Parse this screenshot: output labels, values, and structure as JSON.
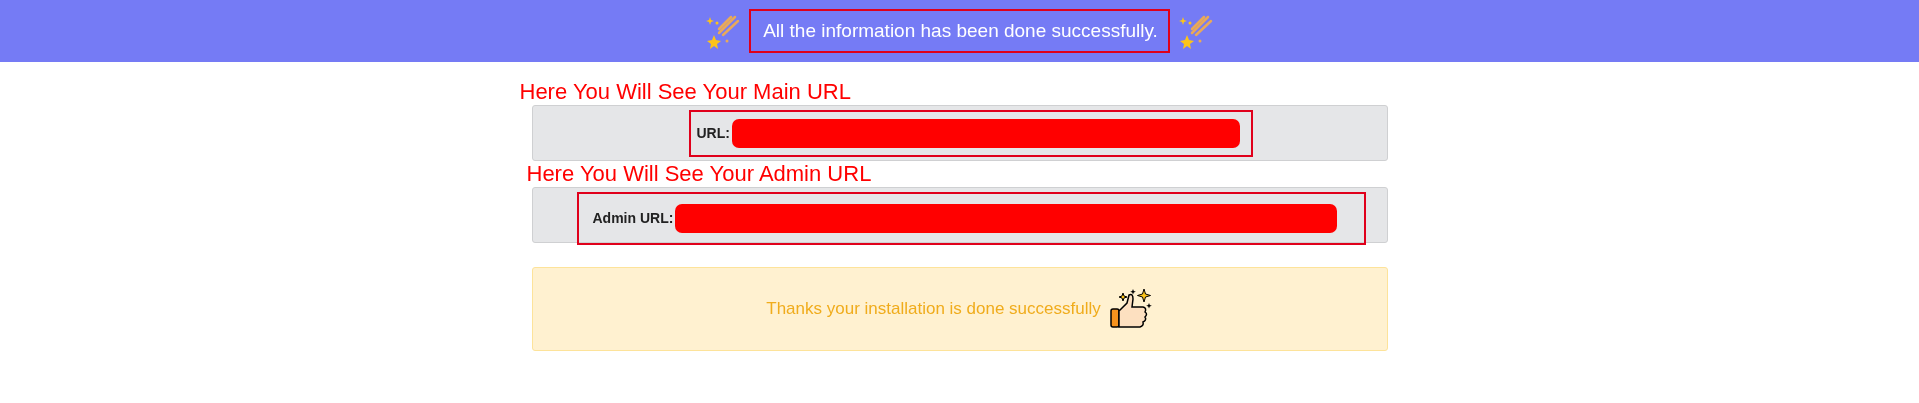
{
  "banner": {
    "message": "All the information has been done successfully."
  },
  "url_sections": [
    {
      "annotation": "Here You Will See Your Main URL",
      "label": "URL:",
      "kind": "main"
    },
    {
      "annotation": "Here You Will See Your Admin URL",
      "label": "Admin URL:",
      "kind": "admin"
    }
  ],
  "alert": {
    "message": "Thanks your installation is done successfully"
  }
}
